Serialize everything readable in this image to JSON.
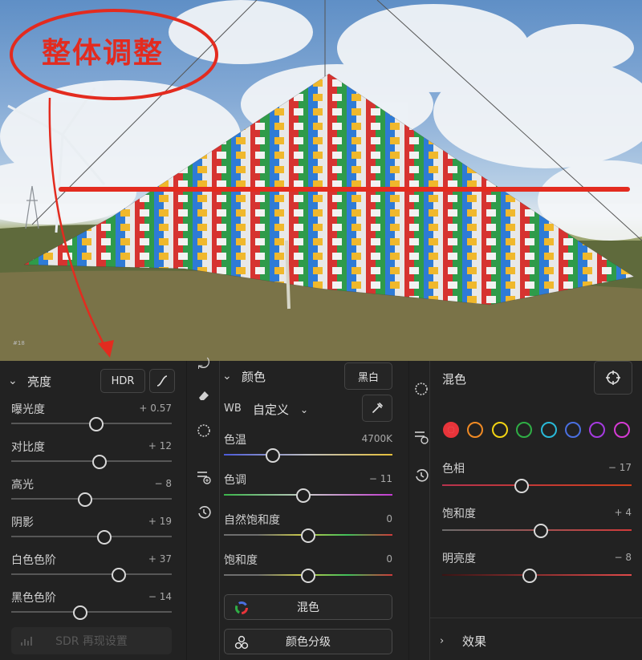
{
  "photo": {
    "annotation_text": "整体调整",
    "watermark": "#18"
  },
  "tone_panel": {
    "title": "亮度",
    "hdr_label": "HDR",
    "curve_icon": "tone-curve-icon",
    "sliders": [
      {
        "label": "曝光度",
        "value": "+ 0.57",
        "position": 0.53
      },
      {
        "label": "对比度",
        "value": "+ 12",
        "position": 0.55
      },
      {
        "label": "高光",
        "value": "− 8",
        "position": 0.46
      },
      {
        "label": "阴影",
        "value": "+ 19",
        "position": 0.58
      },
      {
        "label": "白色色阶",
        "value": "+ 37",
        "position": 0.67
      },
      {
        "label": "黑色色阶",
        "value": "− 14",
        "position": 0.43
      }
    ],
    "sdr_button": "SDR 再现设置"
  },
  "color_panel": {
    "title": "颜色",
    "bw_button": "黑白",
    "wb_label": "WB",
    "wb_value": "自定义",
    "sliders": [
      {
        "label": "色温",
        "value": "4700K",
        "position": 0.29
      },
      {
        "label": "色调",
        "value": "− 11",
        "position": 0.47
      },
      {
        "label": "自然饱和度",
        "value": "0",
        "position": 0.5
      },
      {
        "label": "饱和度",
        "value": "0",
        "position": 0.5
      }
    ],
    "mix_button": "混色",
    "grading_button": "颜色分级"
  },
  "mixer_panel": {
    "title": "混色",
    "swatch_colors": [
      "#e8343a",
      "#f08a24",
      "#f2d313",
      "#2fae45",
      "#29b9d8",
      "#4a6fe0",
      "#a53be0",
      "#d63bd4"
    ],
    "selected_index": 0,
    "sliders": [
      {
        "label": "色相",
        "value": "− 17",
        "position": 0.42
      },
      {
        "label": "饱和度",
        "value": "+ 4",
        "position": 0.52
      },
      {
        "label": "明亮度",
        "value": "− 8",
        "position": 0.46
      }
    ],
    "effects_label": "效果"
  },
  "colors": {
    "annotation_red": "#e32b1f",
    "panel_bg": "#222222",
    "knob_border": "#d8d8d8"
  }
}
